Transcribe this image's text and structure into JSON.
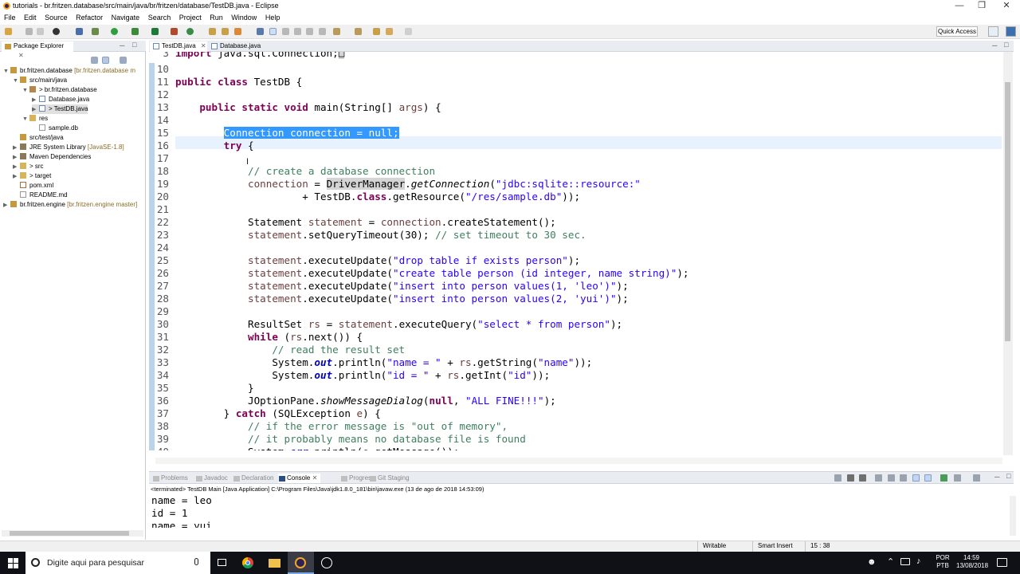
{
  "window": {
    "title": "tutorials - br.fritzen.database/src/main/java/br/fritzen/database/TestDB.java - Eclipse"
  },
  "menu": [
    "File",
    "Edit",
    "Source",
    "Refactor",
    "Navigate",
    "Search",
    "Project",
    "Run",
    "Window",
    "Help"
  ],
  "toolbar": {
    "quick_access": "Quick Access"
  },
  "package_explorer": {
    "tab_label": "Package Explorer",
    "items": [
      {
        "label": "br.fritzen.database",
        "deco": "[br.fritzen.database m",
        "icon": "project-icon"
      },
      {
        "label": "src/main/java",
        "icon": "source-folder-icon"
      },
      {
        "label": "> br.fritzen.database",
        "icon": "package-icon"
      },
      {
        "label": "Database.java",
        "icon": "java-file-icon"
      },
      {
        "label": "> TestDB.java",
        "icon": "java-file-icon"
      },
      {
        "label": "res",
        "icon": "folder-icon"
      },
      {
        "label": "sample.db",
        "icon": "file-icon"
      },
      {
        "label": "src/test/java",
        "icon": "source-folder-icon"
      },
      {
        "label": "JRE System Library",
        "deco": "[JavaSE-1.8]",
        "icon": "library-icon"
      },
      {
        "label": "Maven Dependencies",
        "icon": "library-icon"
      },
      {
        "label": "> src",
        "icon": "folder-icon"
      },
      {
        "label": "> target",
        "icon": "folder-icon"
      },
      {
        "label": "pom.xml",
        "icon": "xml-file-icon"
      },
      {
        "label": "README.md",
        "icon": "file-icon"
      },
      {
        "label": "br.fritzen.engine",
        "deco": "[br.fritzen.engine master]",
        "icon": "project-icon"
      }
    ]
  },
  "editor": {
    "tabs": [
      "TestDB.java",
      "Database.java"
    ],
    "lines": [
      {
        "n": "3",
        "h": "<span class='kw'>import</span> java.sql.Connection;<span class='occ'>&#9633;</span>"
      },
      {
        "n": "10",
        "h": ""
      },
      {
        "n": "11",
        "h": "<span class='kw'>public class</span> TestDB {"
      },
      {
        "n": "12",
        "h": ""
      },
      {
        "n": "13",
        "h": "    <span class='kw'>public static void</span> main(String[] <span class='lv'>args</span>) {"
      },
      {
        "n": "14",
        "h": ""
      },
      {
        "n": "15",
        "h": "        <span class='sel'>Connection connection = null;</span>"
      },
      {
        "n": "16",
        "h": "        <span class='kw'>try</span> {"
      },
      {
        "n": "17",
        "h": ""
      },
      {
        "n": "18",
        "h": "            <span class='cm'>// create a database connection</span>"
      },
      {
        "n": "19",
        "h": "            <span class='lv'>connection</span> = <span class='occ'>DriverManager</span>.<span class='mi'>getConnection</span>(<span class='st'>\"jdbc:sqlite::resource:\"</span>"
      },
      {
        "n": "20",
        "h": "                     + TestDB.<span class='kw'>class</span>.getResource(<span class='st'>\"/res/sample.db\"</span>));"
      },
      {
        "n": "21",
        "h": ""
      },
      {
        "n": "22",
        "h": "            Statement <span class='lv'>statement</span> = <span class='lv'>connection</span>.createStatement();"
      },
      {
        "n": "23",
        "h": "            <span class='lv'>statement</span>.setQueryTimeout(30); <span class='cm'>// set timeout to 30 sec.</span>"
      },
      {
        "n": "24",
        "h": ""
      },
      {
        "n": "25",
        "h": "            <span class='lv'>statement</span>.executeUpdate(<span class='st'>\"drop table if exists person\"</span>);"
      },
      {
        "n": "26",
        "h": "            <span class='lv'>statement</span>.executeUpdate(<span class='st'>\"create table person (id integer, name string)\"</span>);"
      },
      {
        "n": "27",
        "h": "            <span class='lv'>statement</span>.executeUpdate(<span class='st'>\"insert into person values(1, 'leo')\"</span>);"
      },
      {
        "n": "28",
        "h": "            <span class='lv'>statement</span>.executeUpdate(<span class='st'>\"insert into person values(2, 'yui')\"</span>);"
      },
      {
        "n": "29",
        "h": ""
      },
      {
        "n": "30",
        "h": "            ResultSet <span class='lv'>rs</span> = <span class='lv'>statement</span>.executeQuery(<span class='st'>\"select * from person\"</span>);"
      },
      {
        "n": "31",
        "h": "            <span class='kw'>while</span> (<span class='lv'>rs</span>.next()) {"
      },
      {
        "n": "32",
        "h": "                <span class='cm'>// read the result set</span>"
      },
      {
        "n": "33",
        "h": "                System.<span class='fi'>out</span>.println(<span class='st'>\"name = \"</span> + <span class='lv'>rs</span>.getString(<span class='st'>\"name\"</span>));"
      },
      {
        "n": "34",
        "h": "                System.<span class='fi'>out</span>.println(<span class='st'>\"id = \"</span> + <span class='lv'>rs</span>.getInt(<span class='st'>\"id\"</span>));"
      },
      {
        "n": "35",
        "h": "            }"
      },
      {
        "n": "36",
        "h": "            JOptionPane.<span class='mi'>showMessageDialog</span>(<span class='kw'>null</span>, <span class='st'>\"ALL FINE!!!\"</span>);"
      },
      {
        "n": "37",
        "h": "        } <span class='kw'>catch</span> (SQLException <span class='lv'>e</span>) {"
      },
      {
        "n": "38",
        "h": "            <span class='cm'>// if the error message is \"out of memory\",</span>"
      },
      {
        "n": "39",
        "h": "            <span class='cm'>// it probably means no database file is found</span>"
      },
      {
        "n": "40",
        "h": "            System.<span class='fi'>err</span>.println(<span class='lv'>e</span>.getMessage());"
      }
    ]
  },
  "console": {
    "tabs": [
      "Problems",
      "Javadoc",
      "Declaration",
      "Console",
      "Progress",
      "Git Staging"
    ],
    "terminated": "<terminated> TestDB Main [Java Application] C:\\Program Files\\Java\\jdk1.8.0_181\\bin\\javaw.exe (13 de ago de 2018 14:53:09)",
    "output": [
      "name = leo",
      "id = 1",
      "name = yui"
    ]
  },
  "status": {
    "writable": "Writable",
    "insert_mode": "Smart Insert",
    "position": "15 : 38"
  },
  "taskbar": {
    "search_placeholder": "Digite aqui para pesquisar",
    "lang1": "POR",
    "lang2": "PTB",
    "time": "14:59",
    "date": "13/08/2018"
  },
  "colors": {
    "keyword": "#7f0055",
    "comment": "#3f7f5f",
    "string": "#2a00ff",
    "selection": "#3399ff",
    "current_line": "#e8f2fe"
  }
}
